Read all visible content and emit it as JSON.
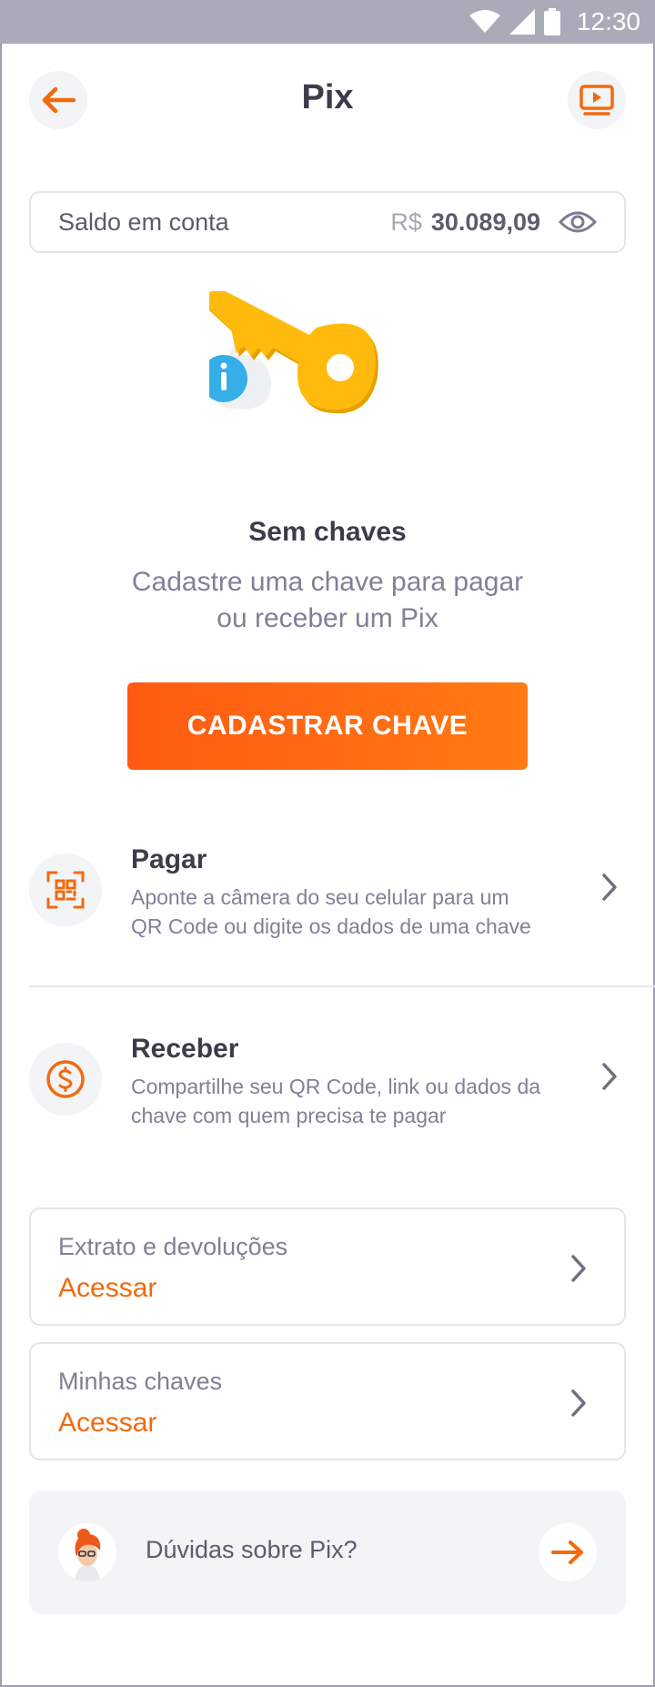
{
  "status_bar": {
    "time": "12:30"
  },
  "header": {
    "title": "Pix",
    "back_icon": "arrow-left-icon",
    "video_icon": "video-play-icon"
  },
  "balance": {
    "label": "Saldo em conta",
    "currency": "R$",
    "value": "30.089,09",
    "visibility_icon": "eye-icon"
  },
  "empty_state": {
    "illustration": "key-info-illustration",
    "title": "Sem chaves",
    "subtitle_line1": "Cadastre uma chave para pagar",
    "subtitle_line2": "ou receber um Pix",
    "cta_label": "CADASTRAR CHAVE"
  },
  "options": {
    "pagar": {
      "title": "Pagar",
      "desc_line1": "Aponte a câmera do seu celular para um",
      "desc_line2": "QR Code ou digite os dados de uma chave",
      "icon": "qr-code-icon"
    },
    "receber": {
      "title": "Receber",
      "desc_line1": "Compartilhe seu QR Code, link ou dados da",
      "desc_line2": "chave com quem precisa te pagar",
      "icon": "dollar-coin-icon"
    }
  },
  "cards": {
    "extrato": {
      "label": "Extrato e devoluções",
      "link": "Acessar"
    },
    "chaves": {
      "label": "Minhas chaves",
      "link": "Acessar"
    }
  },
  "help": {
    "text": "Dúvidas sobre Pix?"
  },
  "colors": {
    "accent": "#f26a0e",
    "cta_start": "#ff5a10",
    "cta_end": "#ff7a14",
    "key_yellow": "#ffbb0d",
    "info_blue": "#36aee8",
    "text_dark": "#3b3d4a",
    "text_muted": "#7f8196"
  }
}
